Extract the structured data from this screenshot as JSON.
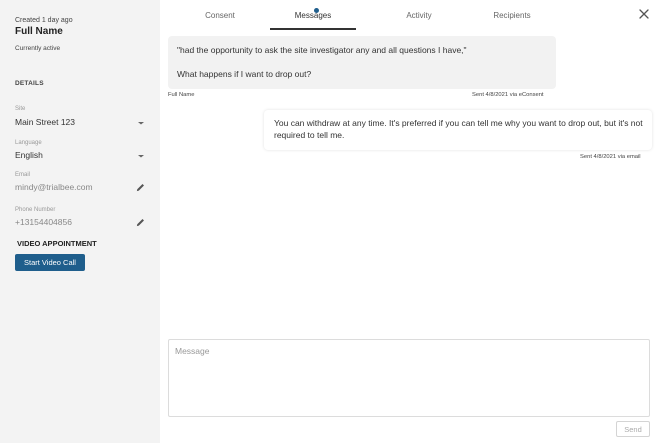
{
  "sidebar": {
    "created": "Created 1 day ago",
    "name": "Full Name",
    "status": "Currently active",
    "details_heading": "DETAILS",
    "site": {
      "label": "Site",
      "value": "Main Street 123"
    },
    "language": {
      "label": "Language",
      "value": "English"
    },
    "email": {
      "label": "Email",
      "value": "mindy@trialbee.com"
    },
    "phone": {
      "label": "Phone Number",
      "value": "+13154404856"
    },
    "video_heading": "VIDEO APPOINTMENT",
    "video_button": "Start Video Call"
  },
  "tabs": [
    {
      "label": "Consent"
    },
    {
      "label": "Messages"
    },
    {
      "label": "Activity"
    },
    {
      "label": "Recipients"
    }
  ],
  "active_tab": "Messages",
  "messages": [
    {
      "line1": "\"had the opportunity to ask the site investigator any and all questions I have,\"",
      "line2": "What happens if I want to drop out?",
      "sender": "Full Name",
      "sent": "Sent 4/8/2021 via eConsent"
    },
    {
      "text": "You can withdraw at any time. It's preferred if you can tell me why you want to drop out, but it's not required to tell me.",
      "sent": "Sent 4/8/2021 via email"
    }
  ],
  "compose": {
    "placeholder": "Message",
    "value": ""
  },
  "send_label": "Send",
  "colors": {
    "accent": "#1f5e8c",
    "sidebar_bg": "#f3f3f3"
  }
}
